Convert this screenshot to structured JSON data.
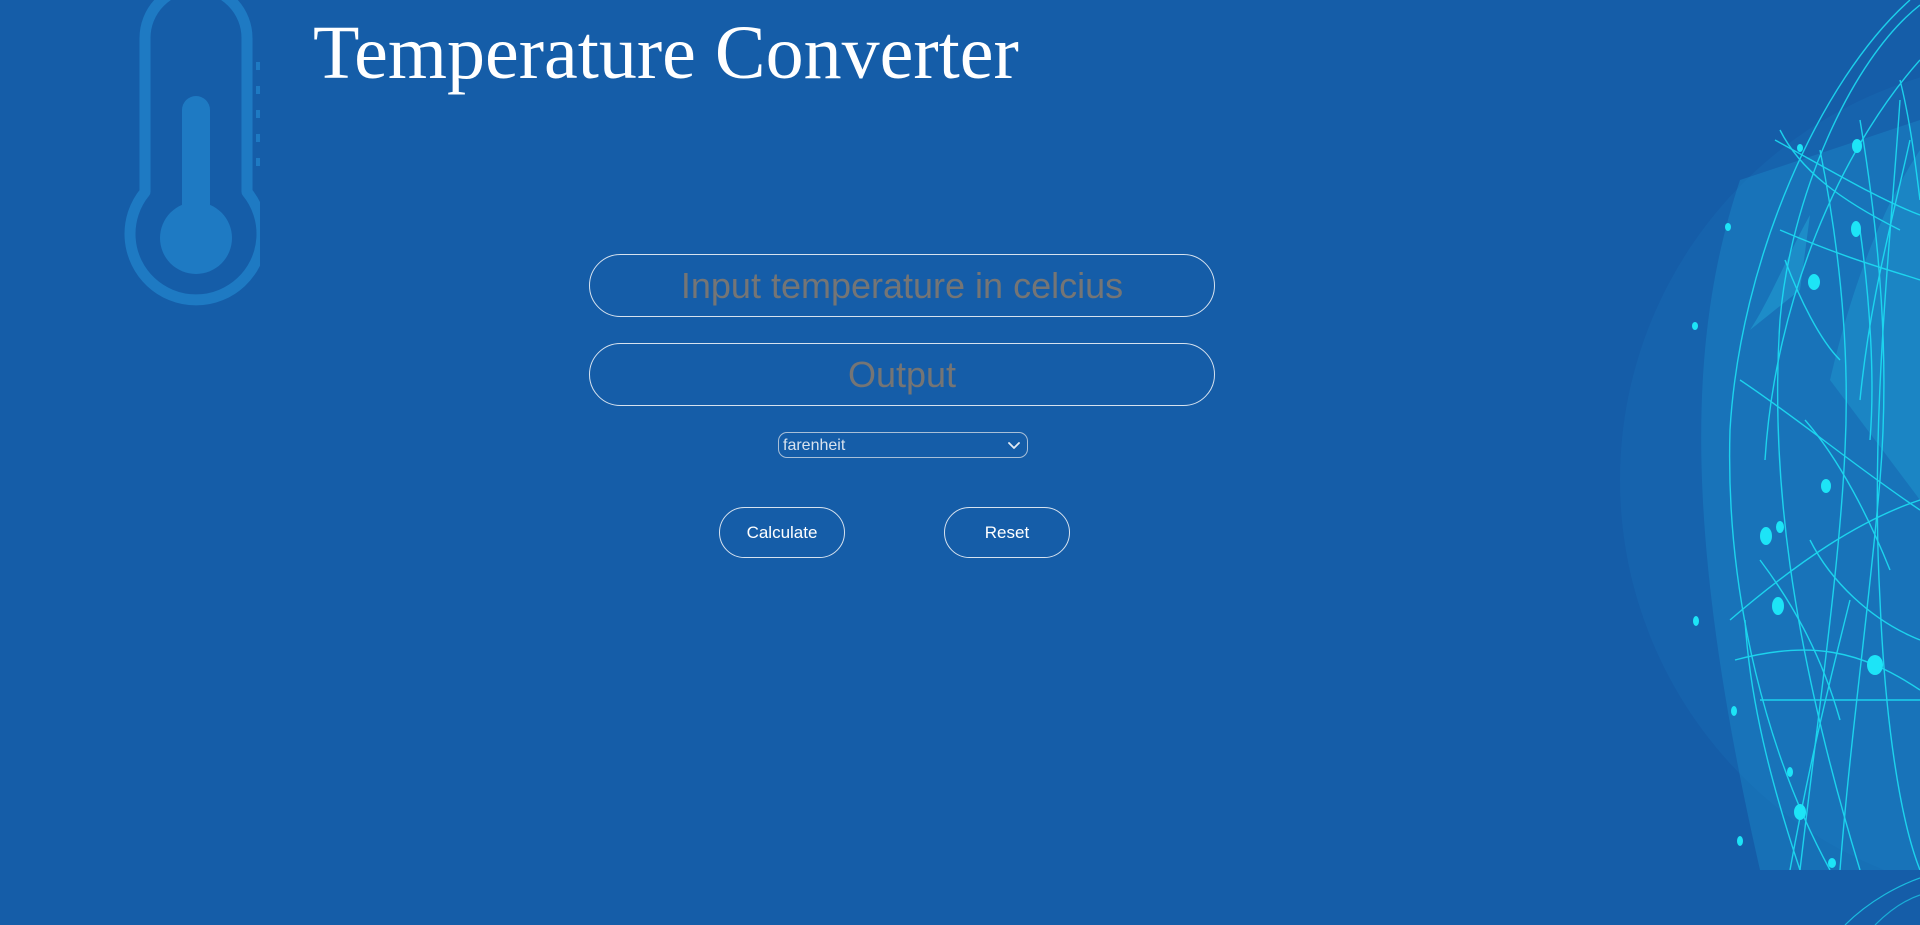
{
  "header": {
    "title": "Temperature Converter"
  },
  "form": {
    "celsius_placeholder": "Input temperature in celcius",
    "output_placeholder": "Output",
    "unit_select": {
      "selected": "farenheit"
    },
    "calculate_label": "Calculate",
    "reset_label": "Reset"
  },
  "decor": {
    "left_icon": "thermometer-icon",
    "right_graphic": "network-globe-graphic"
  },
  "colors": {
    "background": "#155da8",
    "thermometer": "#1e7ac3",
    "globe_lines": "#1de4f7",
    "text": "#ffffff",
    "placeholder": "#757575",
    "border": "#d6e2ef"
  }
}
